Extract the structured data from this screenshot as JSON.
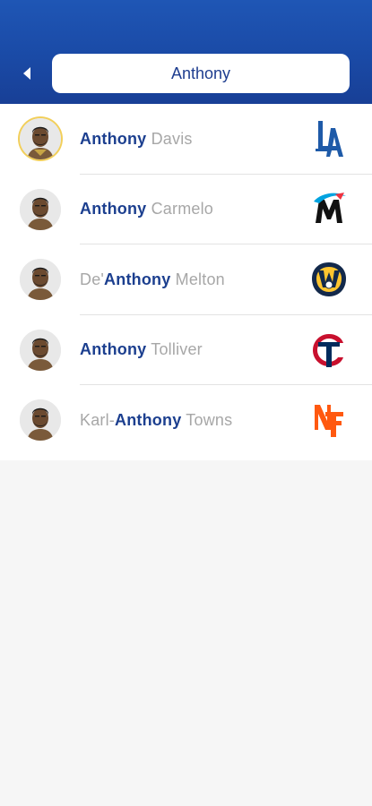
{
  "search": {
    "query": "Anthony"
  },
  "results": [
    {
      "pre": "",
      "match": "Anthony",
      "post": " Davis",
      "team_icon": "la-dodgers-logo-icon",
      "team_color": "#1e5aa8"
    },
    {
      "pre": "",
      "match": "Anthony",
      "post": " Carmelo",
      "team_icon": "miami-marlins-logo-icon",
      "team_color": "#00a3e0"
    },
    {
      "pre": "De'",
      "match": "Anthony",
      "post": " Melton",
      "team_icon": "milwaukee-brewers-logo-icon",
      "team_color": "#ffc52f"
    },
    {
      "pre": "",
      "match": "Anthony",
      "post": " Tolliver",
      "team_icon": "minnesota-twins-logo-icon",
      "team_color": "#c8102e"
    },
    {
      "pre": "Karl-",
      "match": "Anthony",
      "post": " Towns",
      "team_icon": "ny-mets-logo-icon",
      "team_color": "#ff5910"
    }
  ],
  "colors": {
    "header": "#1f56b5",
    "highlight_text": "#1c3f8f",
    "muted_text": "#a7a7a7"
  }
}
